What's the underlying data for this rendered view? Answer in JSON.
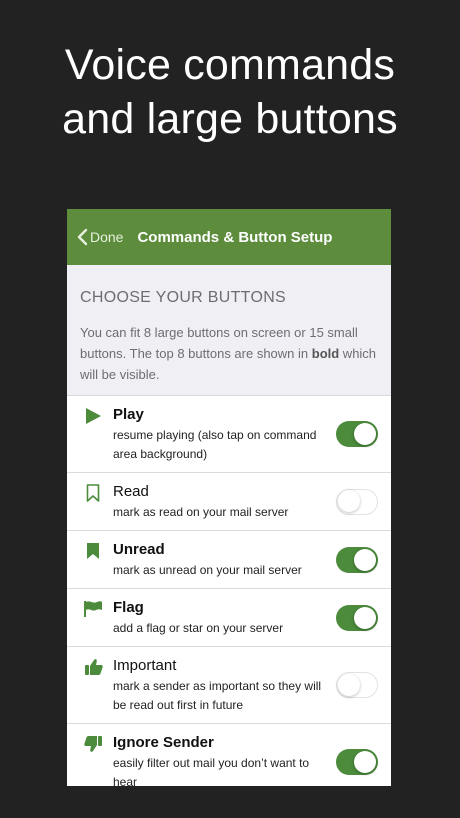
{
  "headline": {
    "line1": "Voice commands",
    "line2": "and large buttons"
  },
  "navbar": {
    "back_label": "Done",
    "title": "Commands & Button Setup"
  },
  "section": {
    "header": "CHOOSE YOUR BUTTONS",
    "desc_before": "You can fit 8 large buttons on screen or 15 small buttons. The top 8 buttons are shown in ",
    "desc_bold": "bold",
    "desc_after": " which will be visible."
  },
  "colors": {
    "accent": "#5c8c3c",
    "toggle_on": "#4b8b3b",
    "background": "#222222"
  },
  "buttons": [
    {
      "name": "Play",
      "desc": "resume playing (also tap on command area background)",
      "icon": "play-icon",
      "bold": true,
      "enabled": true
    },
    {
      "name": "Read",
      "desc": "mark as read on your mail server",
      "icon": "bookmark-outline-icon",
      "bold": false,
      "enabled": false
    },
    {
      "name": "Unread",
      "desc": "mark as unread on your mail server",
      "icon": "bookmark-filled-icon",
      "bold": true,
      "enabled": true
    },
    {
      "name": "Flag",
      "desc": "add a flag or star on your server",
      "icon": "flag-icon",
      "bold": true,
      "enabled": true
    },
    {
      "name": "Important",
      "desc": "mark a sender as important so they will be read out first in future",
      "icon": "thumbs-up-icon",
      "bold": false,
      "enabled": false
    },
    {
      "name": "Ignore Sender",
      "desc": "easily filter out mail you don’t want to hear",
      "icon": "thumbs-down-icon",
      "bold": true,
      "enabled": true
    }
  ]
}
